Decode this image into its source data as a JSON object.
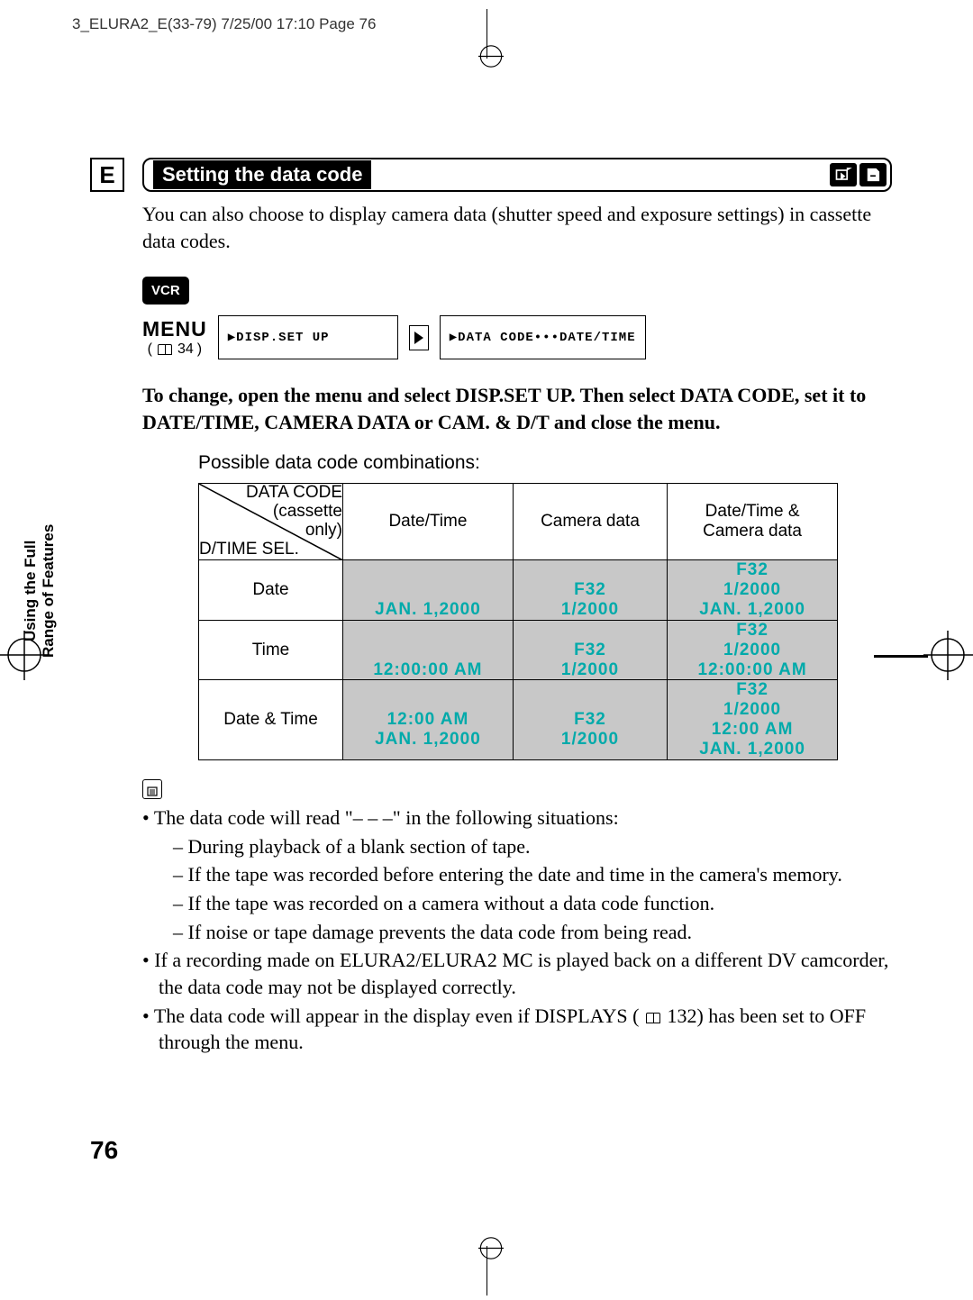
{
  "header_strip": "3_ELURA2_E(33-79)  7/25/00 17:10  Page 76",
  "language_code": "E",
  "section_title": "Setting the data code",
  "intro": "You can also choose to display camera data (shutter speed and exposure settings) in cassette data codes.",
  "vcr_badge": "VCR",
  "menu_word": "MENU",
  "menu_pageref": "34",
  "lcd1": "▶DISP.SET UP",
  "lcd2": "▶DATA CODE•••DATE/TIME",
  "instruction": "To change, open the menu and select DISP.SET UP. Then select DATA CODE, set it to DATE/TIME, CAMERA DATA or CAM. & D/T and close the menu.",
  "combo_caption": "Possible data code combinations:",
  "table": {
    "corner": {
      "top1": "DATA CODE",
      "top2": "(cassette",
      "top3": "only)",
      "bottom": "D/TIME SEL."
    },
    "col_headers": [
      "Date/Time",
      "Camera data",
      "Date/Time &\nCamera data"
    ],
    "rows": [
      {
        "label": "Date",
        "cells": [
          "\n\nJAN. 1,2000",
          "\nF32\n1/2000",
          "F32\n1/2000\nJAN. 1,2000"
        ]
      },
      {
        "label": "Time",
        "cells": [
          "\n\n12:00:00 AM",
          "\nF32\n1/2000",
          "F32\n1/2000\n12:00:00 AM"
        ]
      },
      {
        "label": "Date & Time",
        "cells": [
          "\n12:00 AM\nJAN. 1,2000",
          "\nF32\n1/2000",
          "F32\n1/2000\n12:00 AM\nJAN. 1,2000"
        ],
        "tall": true
      }
    ]
  },
  "notes": {
    "b1": "The data code will read \"– – –\" in the following situations:",
    "d1": "During playback of a blank section of tape.",
    "d2": "If the tape was recorded before entering the date and time in the camera's memory.",
    "d3": "If the tape was recorded on a camera without a data code function.",
    "d4": "If noise or tape damage prevents the data code from being read.",
    "b2": "If a recording made on ELURA2/ELURA2 MC is played back on a different DV camcorder, the data code may not be displayed correctly.",
    "b3_pre": "The data code will appear in the display even if DISPLAYS (",
    "b3_ref": "132",
    "b3_post": ") has been set to OFF through the menu."
  },
  "sidebar": {
    "line1": "Using the Full",
    "line2": "Range of Features"
  },
  "page_num": "76"
}
